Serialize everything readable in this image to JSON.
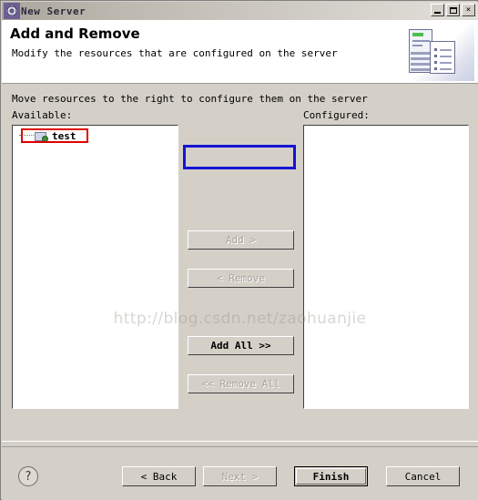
{
  "window": {
    "title": "New Server",
    "title_icon": "gear-icon",
    "controls": {
      "minimize": "minimize-icon",
      "maximize": "maximize-icon",
      "close": "×"
    }
  },
  "header": {
    "title": "Add and Remove",
    "subtitle": "Modify the resources that are configured on the server",
    "art_icon": "server-and-document-icon"
  },
  "main": {
    "instruction": "Move resources to the right to configure them on the server",
    "available_label": "Available:",
    "configured_label": "Configured:",
    "available_items": [
      {
        "label": "test",
        "icon": "web-project-icon"
      }
    ],
    "configured_items": [],
    "transfer_buttons": [
      {
        "label": "Add >",
        "name": "add-button",
        "enabled": false,
        "highlight": "#1414d2"
      },
      {
        "label": "< Remove",
        "name": "remove-button",
        "enabled": false
      },
      {
        "label": "Add All >>",
        "name": "add-all-button",
        "enabled": true
      },
      {
        "label": "<< Remove All",
        "name": "remove-all-button",
        "enabled": false
      }
    ],
    "watermark": "http://blog.csdn.net/zaohuanjie"
  },
  "footer": {
    "help_label": "?",
    "back_label": "< Back",
    "next_label": "Next >",
    "finish_label": "Finish",
    "cancel_label": "Cancel"
  },
  "colors": {
    "window_face": "#d4d0c8",
    "annotation_red": "#e00000",
    "annotation_blue": "#1414d2",
    "disabled_text": "#a8a49c"
  }
}
